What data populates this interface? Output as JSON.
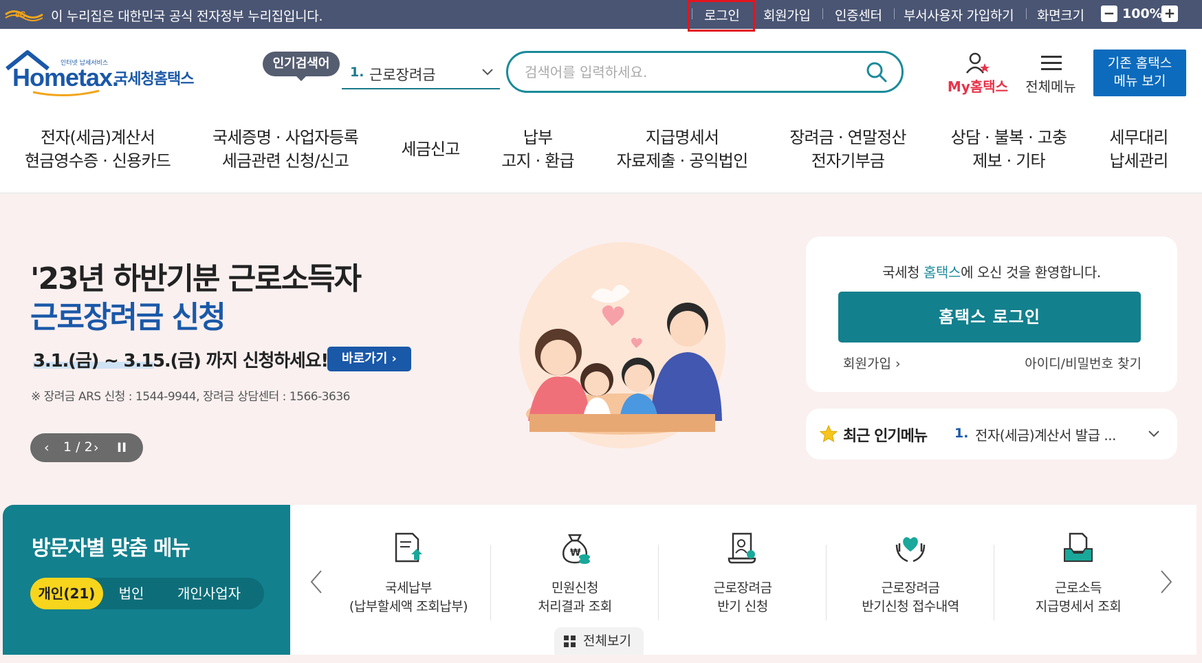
{
  "gov_bar": {
    "notice": "이 누리집은 대한민국 공식 전자정부 누리집입니다.",
    "login": "로그인",
    "signup": "회원가입",
    "cert_center": "인증센터",
    "dept_signup": "부서사용자 가입하기",
    "zoom_label": "화면크기",
    "zoom_value": "100%",
    "zoom_out": "−",
    "zoom_in": "+"
  },
  "header": {
    "logo_text": "Hometax.",
    "logo_sub": "인터넷 납세서비스",
    "logo_kr": "국세청홈택스",
    "popular_badge": "인기검색어",
    "popular_num": "1.",
    "popular_term": "근로장려금",
    "search_placeholder": "검색어를 입력하세요.",
    "my_hometax": "My홈택스",
    "all_menu": "전체메뉴",
    "legacy_line1": "기존 홈택스",
    "legacy_line2": "메뉴 보기"
  },
  "gnb": [
    {
      "line1": "전자(세금)계산서",
      "line2": "현금영수증 · 신용카드"
    },
    {
      "line1": "국세증명 · 사업자등록",
      "line2": "세금관련 신청/신고"
    },
    {
      "line1": "세금신고",
      "line2": ""
    },
    {
      "line1": "납부",
      "line2": "고지 · 환급"
    },
    {
      "line1": "지급명세서",
      "line2": "자료제출 · 공익법인"
    },
    {
      "line1": "장려금 · 연말정산",
      "line2": "전자기부금"
    },
    {
      "line1": "상담 · 불복 · 고충",
      "line2": "제보 · 기타"
    },
    {
      "line1": "세무대리",
      "line2": "납세관리"
    }
  ],
  "hero": {
    "title1": "'23년 하반기분 근로소득자",
    "title2": "근로장려금 신청",
    "period": "3.1.(금) ~ 3.15.(금) 까지 신청하세요!",
    "go_button": "바로가기 ›",
    "note": "※ 장려금 ARS 신청 : 1544-9944, 장려금 상담센터 : 1566-3636",
    "pager_count": "1 / 2",
    "pager_prev": "‹",
    "pager_next": "›",
    "pager_pause": "II"
  },
  "login_card": {
    "welcome_pre": "국세청 ",
    "welcome_accent": "홈택스",
    "welcome_post": "에 오신 것을 환영합니다.",
    "login_button": "홈택스 로그인",
    "join": "회원가입 ›",
    "find": "아이디/비밀번호 찾기"
  },
  "recent_menu": {
    "title": "최근 인기메뉴",
    "num": "1.",
    "item": "전자(세금)계산서 발급 ..."
  },
  "visitor_menu": {
    "title": "방문자별 맞춤 메뉴",
    "tabs": [
      "개인(21)",
      "법인",
      "개인사업자"
    ],
    "items": [
      {
        "line1": "국세납부",
        "line2": "(납부할세액 조회납부)",
        "icon": "tax-payment-icon"
      },
      {
        "line1": "민원신청",
        "line2": "처리결과 조회",
        "icon": "money-bag-icon"
      },
      {
        "line1": "근로장려금",
        "line2": "반기 신청",
        "icon": "certificate-icon"
      },
      {
        "line1": "근로장려금",
        "line2": "반기신청 접수내역",
        "icon": "heart-hands-icon"
      },
      {
        "line1": "근로소득",
        "line2": "지급명세서 조회",
        "icon": "document-tray-icon"
      }
    ],
    "view_all": "전체보기"
  },
  "colors": {
    "gov_bar": "#4a5573",
    "brand_blue": "#1a58a8",
    "teal": "#13808d",
    "hero_bg": "#faf0f0",
    "highlight_red": "#e3141e",
    "yellow_tab": "#f7d51d"
  }
}
